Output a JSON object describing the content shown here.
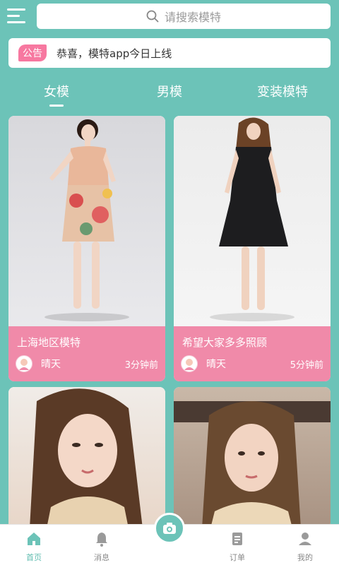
{
  "header": {
    "search_placeholder": "请搜索模特"
  },
  "notice": {
    "badge": "公告",
    "text": "恭喜，模特app今日上线"
  },
  "tabs": [
    {
      "label": "女模",
      "active": true
    },
    {
      "label": "男模",
      "active": false
    },
    {
      "label": "变装模特",
      "active": false
    }
  ],
  "cards": [
    {
      "title": "上海地区模特",
      "user": "晴天",
      "time": "3分钟前",
      "dress_color": "#e8b89a"
    },
    {
      "title": "希望大家多多照顾",
      "user": "晴天",
      "time": "5分钟前",
      "dress_color": "#1d1d1f"
    },
    {
      "title": "",
      "user": "",
      "time": ""
    },
    {
      "title": "",
      "user": "",
      "time": ""
    }
  ],
  "nav": [
    {
      "label": "首页",
      "icon": "home-icon",
      "active": true
    },
    {
      "label": "消息",
      "icon": "bell-icon",
      "active": false
    },
    {
      "label": "",
      "icon": "camera-icon",
      "active": false
    },
    {
      "label": "订单",
      "icon": "document-icon",
      "active": false
    },
    {
      "label": "我的",
      "icon": "user-icon",
      "active": false
    }
  ],
  "colors": {
    "theme": "#6cc3b8",
    "card_info": "#f08aa9",
    "badge": "#f778a0"
  }
}
